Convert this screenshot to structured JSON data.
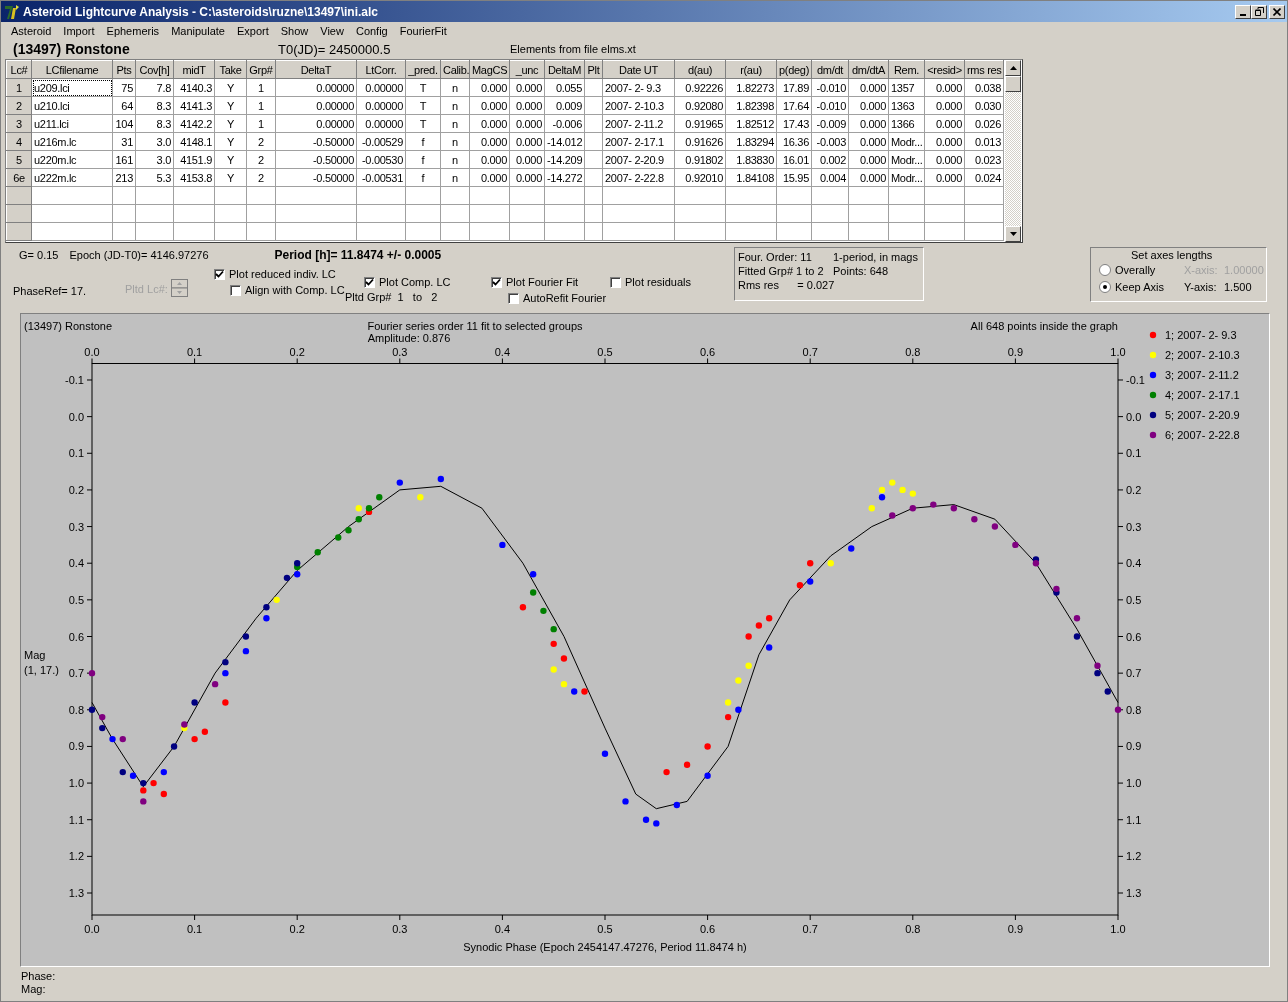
{
  "window": {
    "title": "Asteroid Lightcurve Analysis - C:\\asteroids\\ruzne\\13497\\ini.alc"
  },
  "menu": [
    "Asteroid",
    "Import",
    "Ephemeris",
    "Manipulate",
    "Export",
    "Show",
    "View",
    "Config",
    "FourierFit"
  ],
  "header": {
    "asteroid": "(13497) Ronstone",
    "t0": "T0(JD)= 2450000.5",
    "elements": "Elements from file elms.xt"
  },
  "table": {
    "columns": [
      "Lc#",
      "LCfilename",
      "Pts",
      "Cov[h]",
      "midT",
      "Take",
      "Grp#",
      "DeltaT",
      "LtCorr.",
      "_pred.",
      "Calib.",
      "MagCS",
      "_unc",
      "DeltaM",
      "Plt",
      "Date UT",
      "d(au)",
      "r(au)",
      "p(deg)",
      "dm/dt",
      "dm/dtA",
      "Rem.",
      "<resid>",
      "rms res"
    ],
    "rows": [
      {
        "focused": true,
        "cells": [
          "1",
          "u209.lci",
          "75",
          "7.8",
          "4140.3",
          "Y",
          "1",
          "0.00000",
          "0.00000",
          "T",
          "n",
          "0.000",
          "0.000",
          "0.055",
          null,
          "2007- 2- 9.3",
          "0.92226",
          "1.82273",
          "17.89",
          "-0.010",
          "0.000",
          "1357",
          "0.000",
          "0.038"
        ]
      },
      {
        "focused": false,
        "cells": [
          "2",
          "u210.lci",
          "64",
          "8.3",
          "4141.3",
          "Y",
          "1",
          "0.00000",
          "0.00000",
          "T",
          "n",
          "0.000",
          "0.000",
          "0.009",
          null,
          "2007- 2-10.3",
          "0.92080",
          "1.82398",
          "17.64",
          "-0.010",
          "0.000",
          "1363",
          "0.000",
          "0.030"
        ]
      },
      {
        "focused": false,
        "cells": [
          "3",
          "u211.lci",
          "104",
          "8.3",
          "4142.2",
          "Y",
          "1",
          "0.00000",
          "0.00000",
          "T",
          "n",
          "0.000",
          "0.000",
          "-0.006",
          null,
          "2007- 2-11.2",
          "0.91965",
          "1.82512",
          "17.43",
          "-0.009",
          "0.000",
          "1366",
          "0.000",
          "0.026"
        ]
      },
      {
        "focused": false,
        "cells": [
          "4",
          "u216m.lc",
          "31",
          "3.0",
          "4148.1",
          "Y",
          "2",
          "-0.50000",
          "-0.00529",
          "f",
          "n",
          "0.000",
          "0.000",
          "-14.012",
          null,
          "2007- 2-17.1",
          "0.91626",
          "1.83294",
          "16.36",
          "-0.003",
          "0.000",
          "Modr...",
          "0.000",
          "0.013"
        ]
      },
      {
        "focused": false,
        "cells": [
          "5",
          "u220m.lc",
          "161",
          "3.0",
          "4151.9",
          "Y",
          "2",
          "-0.50000",
          "-0.00530",
          "f",
          "n",
          "0.000",
          "0.000",
          "-14.209",
          null,
          "2007- 2-20.9",
          "0.91802",
          "1.83830",
          "16.01",
          "0.002",
          "0.000",
          "Modr...",
          "0.000",
          "0.023"
        ]
      },
      {
        "focused": false,
        "cells": [
          "6e",
          "u222m.lc",
          "213",
          "5.3",
          "4153.8",
          "Y",
          "2",
          "-0.50000",
          "-0.00531",
          "f",
          "n",
          "0.000",
          "0.000",
          "-14.272",
          null,
          "2007- 2-22.8",
          "0.92010",
          "1.84108",
          "15.95",
          "0.004",
          "0.000",
          "Modr...",
          "0.000",
          "0.024"
        ]
      }
    ]
  },
  "summary": {
    "g": "G= 0.15",
    "epoch": "Epoch (JD-T0)= 4146.97276",
    "period": "Period [h]= 11.8474 +/- 0.0005",
    "phase_ref": "PhaseRef= 17.",
    "pltd_lc": {
      "label": "Pltd Lc#:",
      "disabled": true
    }
  },
  "options": [
    [
      {
        "kind": "checkbox",
        "label": "Plot reduced indiv. LC",
        "checked": true
      },
      {
        "kind": "checkbox",
        "label": "Align with Comp. LC",
        "checked": false
      }
    ],
    [
      {
        "kind": "checkbox",
        "label": "Plot Comp. LC",
        "checked": true
      },
      {
        "kind": "text",
        "label": "Pltd Grp#  1   to   2"
      }
    ],
    [
      {
        "kind": "checkbox",
        "label": "Plot Fourier Fit",
        "checked": true
      },
      {
        "kind": "checkbox",
        "label": "AutoRefit Fourier",
        "checked": false
      }
    ],
    [
      {
        "kind": "checkbox",
        "label": "Plot residuals",
        "checked": false
      }
    ]
  ],
  "fit_info": [
    "Four. Order: 11",
    "1-period, in mags",
    "Fitted Grp# 1 to 2",
    "Points: 648",
    "Rms res      = 0.027"
  ],
  "axes": {
    "title": "Set axes lengths",
    "options": [
      {
        "label": "Overally",
        "selected": false,
        "axis_label": "X-axis:",
        "value": "1.00000",
        "disabled": true
      },
      {
        "label": "Keep Axis",
        "selected": true,
        "axis_label": "Y-axis:",
        "value": "1.500",
        "disabled": false
      }
    ]
  },
  "plot": {
    "object": "(13497) Ronstone",
    "amplitude": "Amplitude: 0.876",
    "points_note": "All 648 points inside the graph",
    "ylabel_note": "(1, 17.)",
    "chart_data": {
      "type": "scatter",
      "title": "Fourier series order 11 fit to selected groups",
      "legend": "right",
      "xlabel": "Synodic Phase (Epoch 2454147.47276, Period 11.8474 h)",
      "ylabel": "Mag",
      "xlim": [
        0,
        1
      ],
      "ylim": [
        1.36,
        -0.145
      ],
      "xticks": [
        {
          "value": 0,
          "label": "0.0"
        },
        {
          "value": 0.1,
          "label": "0.1"
        },
        {
          "value": 0.2,
          "label": "0.2"
        },
        {
          "value": 0.3,
          "label": "0.3"
        },
        {
          "value": 0.4,
          "label": "0.4"
        },
        {
          "value": 0.5,
          "label": "0.5"
        },
        {
          "value": 0.6,
          "label": "0.6"
        },
        {
          "value": 0.7,
          "label": "0.7"
        },
        {
          "value": 0.8,
          "label": "0.8"
        },
        {
          "value": 0.9,
          "label": "0.9"
        },
        {
          "value": 1,
          "label": "1.0"
        }
      ],
      "yticks": [
        {
          "value": -0.1,
          "label": "-0.1"
        },
        {
          "value": 0,
          "label": "0.0"
        },
        {
          "value": 0.1,
          "label": "0.1"
        },
        {
          "value": 0.2,
          "label": "0.2"
        },
        {
          "value": 0.3,
          "label": "0.3"
        },
        {
          "value": 0.4,
          "label": "0.4"
        },
        {
          "value": 0.5,
          "label": "0.5"
        },
        {
          "value": 0.6,
          "label": "0.6"
        },
        {
          "value": 0.7,
          "label": "0.7"
        },
        {
          "value": 0.8,
          "label": "0.8"
        },
        {
          "value": 0.9,
          "label": "0.9"
        },
        {
          "value": 1,
          "label": "1.0"
        },
        {
          "value": 1.1,
          "label": "1.1"
        },
        {
          "value": 1.2,
          "label": "1.2"
        },
        {
          "value": 1.3,
          "label": "1.3"
        }
      ],
      "series": [
        {
          "name": "1; 2007- 2- 9.3",
          "color": "#ff0000",
          "x": [
            0.05,
            0.06,
            0.07,
            0.1,
            0.11,
            0.13,
            0.27,
            0.42,
            0.45,
            0.46,
            0.48,
            0.56,
            0.58,
            0.6,
            0.62,
            0.64,
            0.65,
            0.66,
            0.69,
            0.7
          ],
          "values": [
            1.02,
            1.0,
            1.03,
            0.88,
            0.86,
            0.78,
            0.26,
            0.52,
            0.62,
            0.66,
            0.75,
            0.97,
            0.95,
            0.9,
            0.82,
            0.6,
            0.57,
            0.55,
            0.46,
            0.4
          ]
        },
        {
          "name": "2; 2007- 2-10.3",
          "color": "#ffff00",
          "x": [
            0.09,
            0.18,
            0.26,
            0.32,
            0.45,
            0.46,
            0.62,
            0.63,
            0.64,
            0.72,
            0.76,
            0.77,
            0.78,
            0.79,
            0.8
          ],
          "values": [
            0.85,
            0.5,
            0.25,
            0.22,
            0.69,
            0.73,
            0.78,
            0.72,
            0.68,
            0.4,
            0.25,
            0.2,
            0.18,
            0.2,
            0.21
          ]
        },
        {
          "name": "3; 2007- 2-11.2",
          "color": "#0000ff",
          "x": [
            0.02,
            0.04,
            0.07,
            0.13,
            0.17,
            0.2,
            0.15,
            0.3,
            0.34,
            0.4,
            0.43,
            0.47,
            0.5,
            0.52,
            0.54,
            0.55,
            0.57,
            0.6,
            0.63,
            0.66,
            0.7,
            0.74,
            0.77
          ],
          "values": [
            0.88,
            0.98,
            0.97,
            0.7,
            0.55,
            0.43,
            0.64,
            0.18,
            0.17,
            0.35,
            0.43,
            0.75,
            0.92,
            1.05,
            1.1,
            1.11,
            1.06,
            0.98,
            0.8,
            0.63,
            0.45,
            0.36,
            0.22
          ]
        },
        {
          "name": "4; 2007- 2-17.1",
          "color": "#008000",
          "x": [
            0.2,
            0.22,
            0.24,
            0.25,
            0.26,
            0.27,
            0.28,
            0.43,
            0.44,
            0.45
          ],
          "values": [
            0.41,
            0.37,
            0.33,
            0.31,
            0.28,
            0.25,
            0.22,
            0.48,
            0.53,
            0.58
          ]
        },
        {
          "name": "5; 2007- 2-20.9",
          "color": "#000080",
          "x": [
            0.0,
            0.01,
            0.03,
            0.05,
            0.08,
            0.1,
            0.13,
            0.15,
            0.17,
            0.19,
            0.2,
            0.92,
            0.94,
            0.96,
            0.98,
            0.99
          ],
          "values": [
            0.8,
            0.85,
            0.97,
            1.0,
            0.9,
            0.78,
            0.67,
            0.6,
            0.52,
            0.44,
            0.4,
            0.39,
            0.48,
            0.6,
            0.7,
            0.75
          ]
        },
        {
          "name": "6; 2007- 2-22.8",
          "color": "#800080",
          "x": [
            0.0,
            0.01,
            0.03,
            0.05,
            0.09,
            0.12,
            0.78,
            0.8,
            0.82,
            0.84,
            0.86,
            0.88,
            0.9,
            0.92,
            0.94,
            0.96,
            0.98,
            1.0
          ],
          "values": [
            0.7,
            0.82,
            0.88,
            1.05,
            0.84,
            0.73,
            0.27,
            0.25,
            0.24,
            0.25,
            0.28,
            0.3,
            0.35,
            0.4,
            0.47,
            0.55,
            0.68,
            0.8
          ]
        },
        {
          "type": "line",
          "color": "#000000",
          "x": [
            0,
            0.02,
            0.05,
            0.08,
            0.12,
            0.16,
            0.2,
            0.25,
            0.3,
            0.34,
            0.38,
            0.42,
            0.46,
            0.5,
            0.53,
            0.55,
            0.58,
            0.62,
            0.65,
            0.68,
            0.72,
            0.76,
            0.8,
            0.84,
            0.88,
            0.92,
            0.96,
            1
          ],
          "values": [
            0.78,
            0.88,
            1.01,
            0.9,
            0.7,
            0.55,
            0.42,
            0.3,
            0.2,
            0.19,
            0.25,
            0.4,
            0.6,
            0.85,
            1.03,
            1.07,
            1.05,
            0.9,
            0.65,
            0.5,
            0.38,
            0.3,
            0.25,
            0.24,
            0.28,
            0.4,
            0.58,
            0.78
          ]
        }
      ]
    }
  },
  "status": {
    "phase": "Phase:",
    "mag": "Mag:"
  }
}
